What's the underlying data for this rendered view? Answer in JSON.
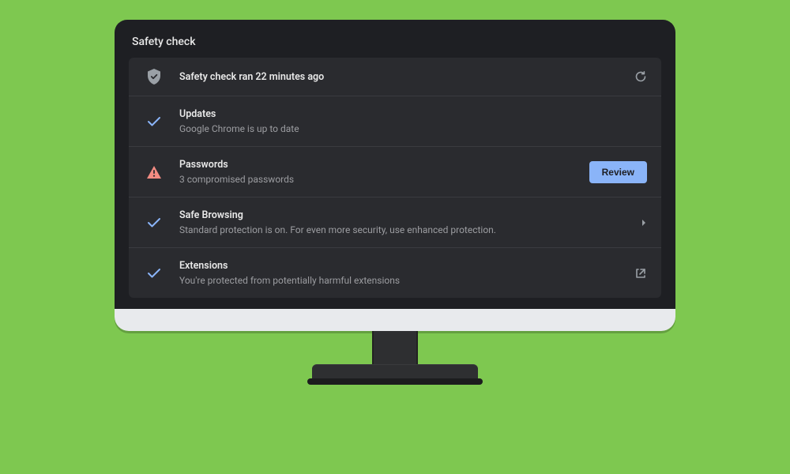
{
  "title": "Safety check",
  "header": {
    "status": "Safety check ran 22 minutes ago"
  },
  "rows": {
    "updates": {
      "title": "Updates",
      "subtitle": "Google Chrome is up to date"
    },
    "passwords": {
      "title": "Passwords",
      "subtitle": "3 compromised passwords",
      "action_label": "Review"
    },
    "safe_browsing": {
      "title": "Safe Browsing",
      "subtitle": "Standard protection is on. For even more security, use enhanced protection."
    },
    "extensions": {
      "title": "Extensions",
      "subtitle": "You're protected from potentially harmful extensions"
    }
  },
  "colors": {
    "accent_blue": "#8ab4f8",
    "check_blue": "#8ab4f8",
    "warning_red": "#f28b82",
    "icon_grey": "#9aa0a6"
  }
}
